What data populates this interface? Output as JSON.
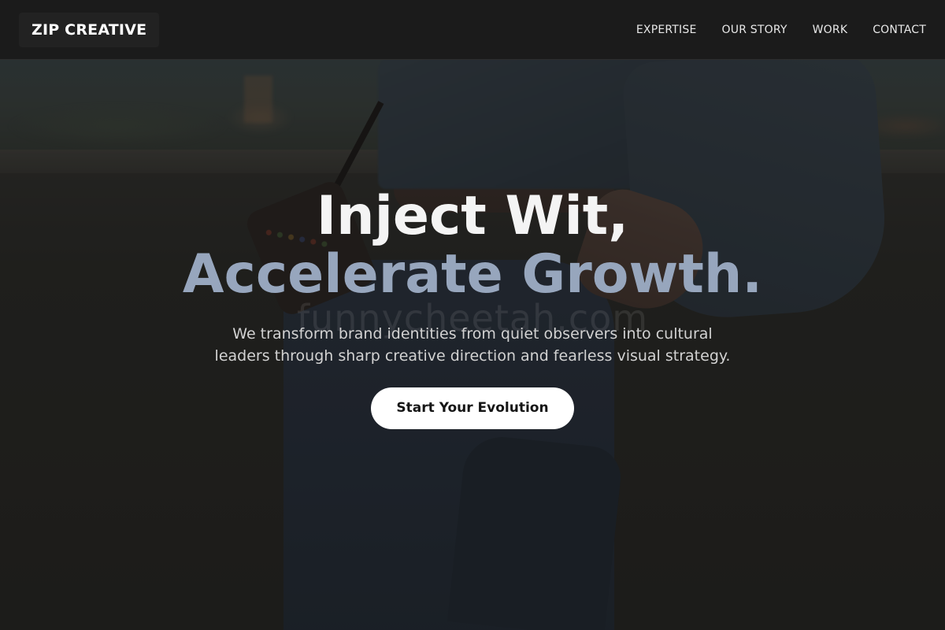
{
  "header": {
    "logo": "ZIP CREATIVE",
    "nav": [
      {
        "label": "EXPERTISE"
      },
      {
        "label": "OUR STORY"
      },
      {
        "label": "WORK"
      },
      {
        "label": "CONTACT"
      }
    ]
  },
  "hero": {
    "headline_line1": "Inject Wit,",
    "headline_line2": "Accelerate Growth.",
    "subtext": "We transform brand identities from quiet observers into cultural leaders through sharp creative direction and fearless visual strategy.",
    "cta_label": "Start Your Evolution",
    "watermark": "funnycheetah.com"
  },
  "colors": {
    "header_bg": "#1b1b1b",
    "headline_primary": "#f4f4f4",
    "headline_accent": "#97a6bd",
    "cta_bg": "#ffffff"
  }
}
